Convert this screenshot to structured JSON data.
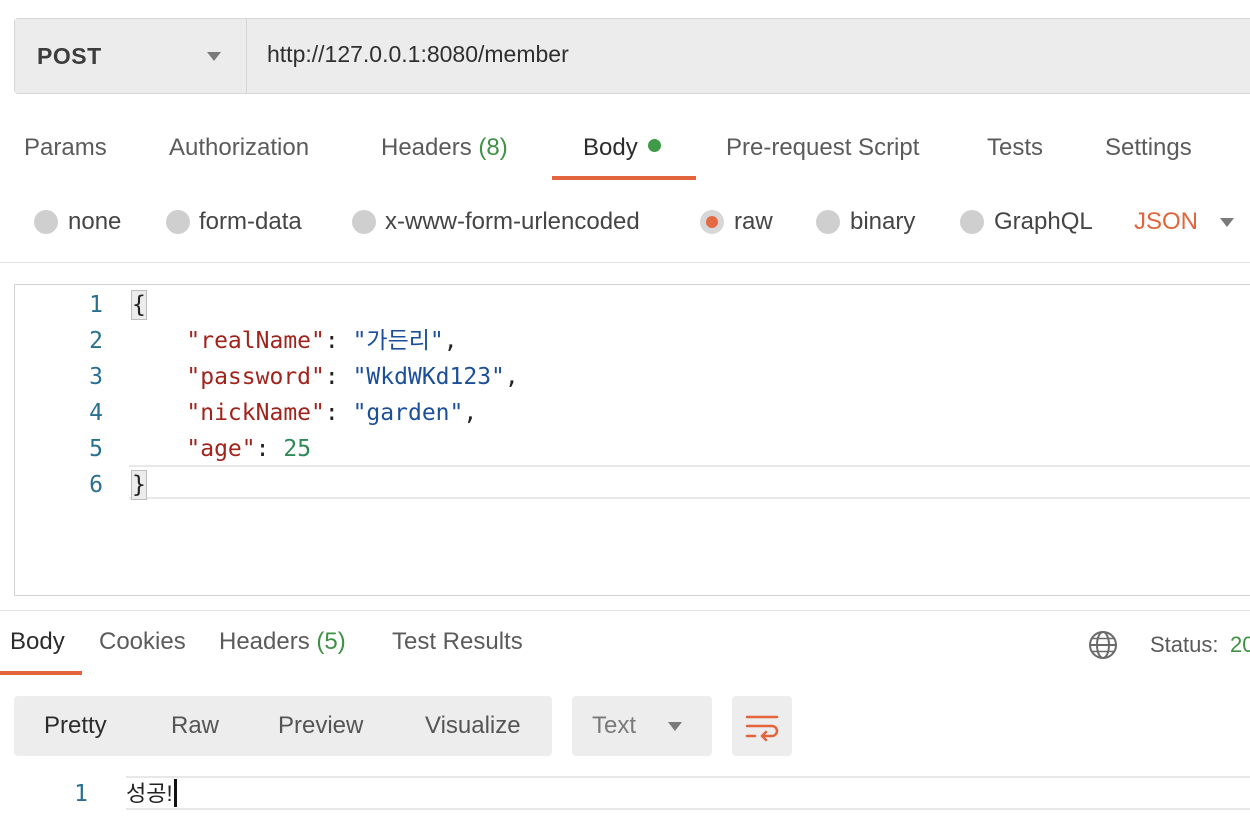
{
  "request": {
    "method": "POST",
    "url": "http://127.0.0.1:8080/member"
  },
  "request_tabs": [
    {
      "label": "Params"
    },
    {
      "label": "Authorization"
    },
    {
      "label": "Headers",
      "count": "(8)"
    },
    {
      "label": "Body",
      "active": true
    },
    {
      "label": "Pre-request Script"
    },
    {
      "label": "Tests"
    },
    {
      "label": "Settings"
    }
  ],
  "body_types": {
    "options": [
      "none",
      "form-data",
      "x-www-form-urlencoded",
      "raw",
      "binary",
      "GraphQL"
    ],
    "selected": "raw",
    "format": "JSON"
  },
  "editor": {
    "line_numbers": [
      "1",
      "2",
      "3",
      "4",
      "5",
      "6"
    ],
    "open_brace": "{",
    "close_brace": "}",
    "colon": ": ",
    "comma": ",",
    "fields": [
      {
        "key": "\"realName\"",
        "value": "\"가든리\"",
        "type": "string",
        "trailing": ","
      },
      {
        "key": "\"password\"",
        "value": "\"WkdWKd123\"",
        "type": "string",
        "trailing": ","
      },
      {
        "key": "\"nickName\"",
        "value": "\"garden\"",
        "type": "string",
        "trailing": ","
      },
      {
        "key": "\"age\"",
        "value": "25",
        "type": "number",
        "trailing": ""
      }
    ]
  },
  "response_tabs": [
    {
      "label": "Body",
      "active": true
    },
    {
      "label": "Cookies"
    },
    {
      "label": "Headers",
      "count": "(5)"
    },
    {
      "label": "Test Results"
    }
  ],
  "response_status": {
    "label": "Status:",
    "value": "20"
  },
  "response_toolbar": {
    "formats": [
      "Pretty",
      "Raw",
      "Preview",
      "Visualize"
    ],
    "active_format": "Pretty",
    "text_type": "Text"
  },
  "response_body": {
    "line_number": "1",
    "text": "성공!"
  },
  "colors": {
    "accent": "#e2653d",
    "green": "#3f9145",
    "json_key": "#a1241c",
    "json_string": "#1b4f9a",
    "json_number": "#2f8a57"
  },
  "icons": [
    "chevron-down-icon",
    "globe-icon",
    "wrap-lines-icon"
  ]
}
